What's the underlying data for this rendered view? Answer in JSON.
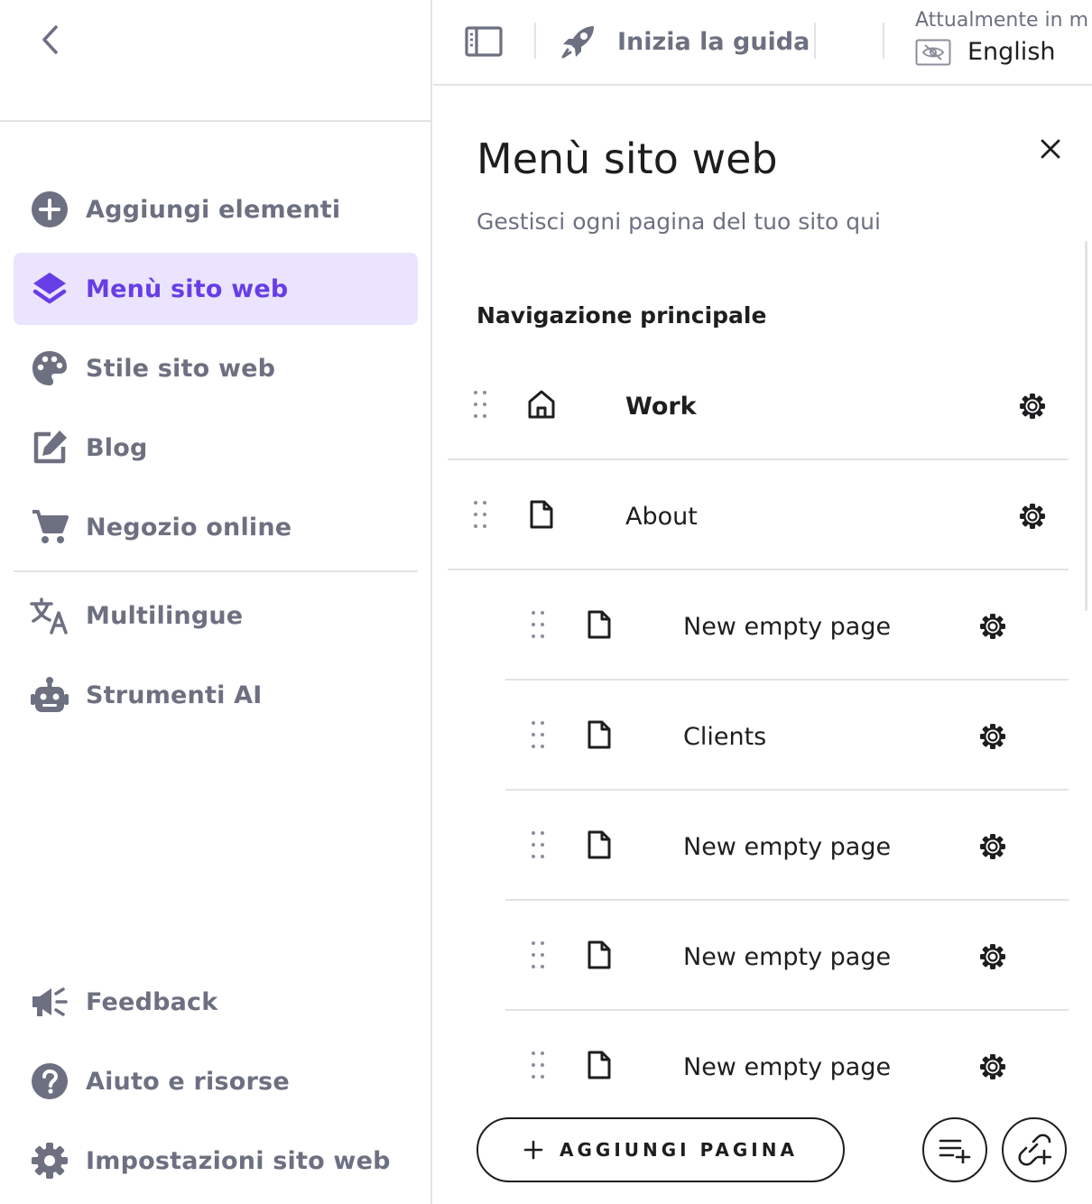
{
  "sidebar": {
    "back_icon": "chevron-left-icon",
    "items": [
      {
        "label": "Aggiungi elementi",
        "icon": "plus-circle-icon"
      },
      {
        "label": "Menù sito web",
        "icon": "layers-icon",
        "active": true
      },
      {
        "label": "Stile sito web",
        "icon": "palette-icon"
      },
      {
        "label": "Blog",
        "icon": "edit-icon"
      },
      {
        "label": "Negozio online",
        "icon": "cart-icon"
      },
      {
        "label": "Multilingue",
        "icon": "translate-icon"
      },
      {
        "label": "Strumenti AI",
        "icon": "robot-icon"
      }
    ],
    "footer_items": [
      {
        "label": "Feedback",
        "icon": "megaphone-icon"
      },
      {
        "label": "Aiuto e risorse",
        "icon": "help-icon"
      },
      {
        "label": "Impostazioni sito web",
        "icon": "settings-icon"
      }
    ]
  },
  "topbar": {
    "guide_label": "Inizia la guida",
    "language_caption": "Attualmente in m",
    "language": "English"
  },
  "panel": {
    "title": "Menù sito web",
    "subtitle": "Gestisci ogni pagina del tuo sito qui",
    "section_title": "Navigazione principale",
    "pages": [
      {
        "name": "Work",
        "type": "home",
        "level": 0
      },
      {
        "name": "About",
        "type": "page",
        "level": 0
      },
      {
        "name": "New empty page",
        "type": "page",
        "level": 1
      },
      {
        "name": "Clients",
        "type": "page",
        "level": 1
      },
      {
        "name": "New empty page",
        "type": "page",
        "level": 1
      },
      {
        "name": "New empty page",
        "type": "page",
        "level": 1
      },
      {
        "name": "New empty page",
        "type": "page",
        "level": 1
      }
    ],
    "add_page_label": "AGGIUNGI PAGINA"
  },
  "colors": {
    "accent": "#673de6",
    "accent_bg": "#ebe4ff",
    "muted_text": "#6d7081",
    "divider": "#e3e3e6"
  }
}
